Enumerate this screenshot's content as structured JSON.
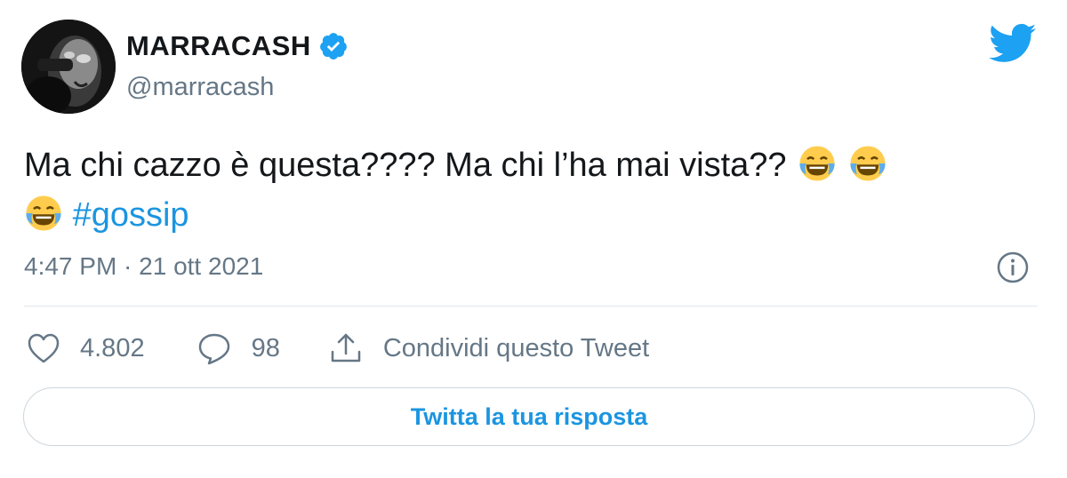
{
  "user": {
    "name": "MARRACASH",
    "handle": "@marracash",
    "verified": true
  },
  "tweet": {
    "text": "Ma chi cazzo è questa???? Ma chi l’ha mai vista??",
    "emojis": [
      "face-with-tears-of-joy",
      "face-with-tears-of-joy",
      "face-with-tears-of-joy"
    ],
    "hashtag": "#gossip",
    "timestamp": "4:47 PM · 21 ott 2021"
  },
  "actions": {
    "likes": "4.802",
    "replies": "98",
    "share_label": "Condividi questo Tweet"
  },
  "reply_button_label": "Twitta la tua risposta",
  "colors": {
    "accent": "#1b95e0",
    "text": "#14171a",
    "secondary": "#657786",
    "border": "#e1e8ed"
  }
}
